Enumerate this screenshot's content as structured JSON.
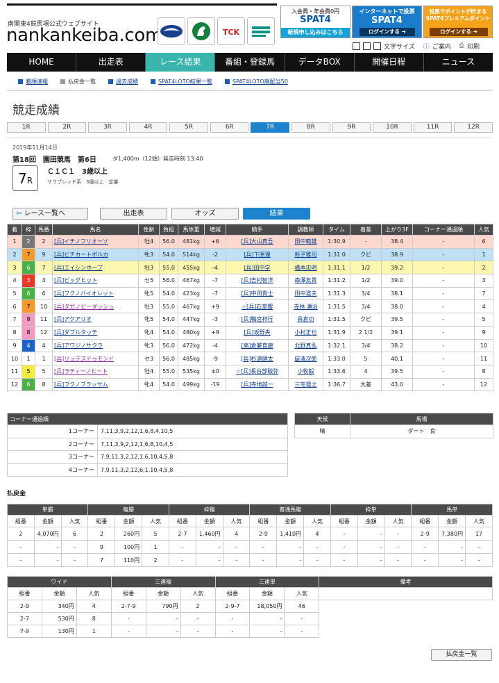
{
  "header": {
    "site_subtitle": "南関東4競馬場公式ウェブサイト",
    "site_logo": "nankankeiba.com",
    "banners": [
      {
        "top": "入会費・年会費0円",
        "mid": "SPAT4",
        "bot": "新規申し込みはこちら"
      },
      {
        "top": "インターネットで投票",
        "mid": "SPAT4",
        "bot": "ログインする ➜"
      },
      {
        "top": "投票でポイントが貯まる SPAT4プレミアムポイント",
        "bot": "ログインする ➜"
      }
    ],
    "util": {
      "font_size": "文字サイズ",
      "guide": "ご案内",
      "print": "印刷"
    }
  },
  "nav": [
    "HOME",
    "出走表",
    "レース結果",
    "番組・登録馬",
    "データBOX",
    "開催日程",
    "ニュース"
  ],
  "subnav": [
    "着順速報",
    "払戻金一覧",
    "過去成績",
    "SPAT4LOTO結果一覧",
    "SPAT4LOTO高配当50"
  ],
  "page_title": "競走成績",
  "race_tabs": [
    "1R",
    "2R",
    "3R",
    "4R",
    "5R",
    "6R",
    "7R",
    "8R",
    "9R",
    "10R",
    "11R",
    "12R"
  ],
  "race": {
    "date": "2019年11月14日",
    "meet": "第18回　園田競馬　第6日",
    "detail": "ダ1,400m（12頭）発走時刻 13:40",
    "class": "Ｃ１Ｃ１　3歳以上",
    "num": "7",
    "num_suffix": "R",
    "cond": "サラブレッド系　3歳以上　定量"
  },
  "buttons": {
    "back": "レース一覧へ",
    "entry": "出走表",
    "odds": "オッズ",
    "result": "結果"
  },
  "results": {
    "headers": [
      "着",
      "枠",
      "馬番",
      "馬名",
      "性齢",
      "負担",
      "馬体重",
      "増減",
      "騎手",
      "調教師",
      "タイム",
      "着差",
      "上がり3F",
      "コーナー通過順",
      "人気"
    ],
    "rows": [
      [
        "1",
        "2",
        "2",
        "[兵]イチノフリオーソ",
        "牡4",
        "56.0",
        "481kg",
        "+6",
        "[兵]大山真吾",
        "田中範雄",
        "1:30.9",
        "-",
        "38.4",
        "-",
        "6"
      ],
      [
        "2",
        "7",
        "9",
        "[兵]ビチカートポルカ",
        "牝3",
        "54.0",
        "514kg",
        "-2",
        "[兵]下原理",
        "新子雅司",
        "1:31.0",
        "クビ",
        "38.9",
        "-",
        "1"
      ],
      [
        "3",
        "6",
        "7",
        "[兵]エイシンホープ",
        "牡3",
        "55.0",
        "455kg",
        "-4",
        "[兵]田中学",
        "橋本忠明",
        "1:31.1",
        "1/2",
        "39.2",
        "-",
        "2"
      ],
      [
        "4",
        "3",
        "3",
        "[兵]ビッグヒット",
        "セ5",
        "56.0",
        "467kg",
        "-7",
        "[兵]吉村智洋",
        "森澤友貴",
        "1:31.2",
        "1/2",
        "39.0",
        "-",
        "3"
      ],
      [
        "5",
        "6",
        "6",
        "[兵]フクノバイオレット",
        "牝5",
        "54.0",
        "423kg",
        "-7",
        "[兵]中田貴士",
        "田中道夫",
        "1:31.3",
        "3/4",
        "38.1",
        "-",
        "7"
      ],
      [
        "6",
        "7",
        "10",
        "[兵]タガノビーダッシュ",
        "牡3",
        "55.0",
        "467kg",
        "+9",
        "☆[兵]石堂響",
        "寺林 瀬治",
        "1:31.5",
        "3/4",
        "38.0",
        "-",
        "4"
      ],
      [
        "7",
        "8",
        "11",
        "[兵]アクアリオ",
        "牝5",
        "54.0",
        "447kg",
        "-3",
        "[兵]鴨宮祥行",
        "長倉功",
        "1:31.5",
        "クビ",
        "39.5",
        "-",
        "5"
      ],
      [
        "8",
        "8",
        "12",
        "[兵]ダブルタッチ",
        "牝4",
        "54.0",
        "480kg",
        "+9",
        "[兵]坂野央",
        "小村正也",
        "1:31.9",
        "2 1/2",
        "39.1",
        "-",
        "9"
      ],
      [
        "9",
        "4",
        "4",
        "[兵]アワジノサクラ",
        "牝3",
        "56.0",
        "472kg",
        "-4",
        "[高]倉兼育康",
        "北野真弘",
        "1:32.1",
        "3/4",
        "38.2",
        "-",
        "10"
      ],
      [
        "10",
        "1",
        "1",
        "[兵]リュデスドゥモンド",
        "セ3",
        "56.0",
        "485kg",
        "-9",
        "[兵]杉浦健太",
        "碇清次郎",
        "1:33.0",
        "5",
        "40.1",
        "-",
        "11"
      ],
      [
        "11",
        "5",
        "5",
        "[兵]ラティーノヒート",
        "牡4",
        "55.0",
        "535kg",
        "±0",
        "☆[兵]長谷部駿弥",
        "小牧毅",
        "1:33.6",
        "4",
        "39.5",
        "-",
        "8"
      ],
      [
        "12",
        "6",
        "8",
        "[兵]フクノブラッサム",
        "牝4",
        "54.0",
        "499kg",
        "-19",
        "[兵]寺地誠一",
        "三宅邉之",
        "1:36.7",
        "大差",
        "43.0",
        "-",
        "12"
      ]
    ]
  },
  "corners": {
    "title": "コーナー通過順",
    "rows": [
      [
        "1コーナー",
        "7,11,3,9,2,12,1,6,8,4,10,5"
      ],
      [
        "2コーナー",
        "7,11,3,9,2,12,1,6,8,10,4,5"
      ],
      [
        "3コーナー",
        "7,9,11,3,2,12,1,6,10,4,5,8"
      ],
      [
        "4コーナー",
        "7,9,11,3,2,12,6,1,10,4,5,8"
      ]
    ]
  },
  "weather": {
    "headers": [
      "天候",
      "馬場"
    ],
    "values": [
      "晴",
      "ダート　良"
    ]
  },
  "payout": {
    "title": "払戻金",
    "group1_headers": [
      "単勝",
      "複勝",
      "枠複",
      "普通馬複",
      "枠単",
      "馬単"
    ],
    "sub_headers": [
      "組番",
      "金額",
      "人気"
    ],
    "group1_rows": [
      [
        "2",
        "4,070円",
        "6",
        "2",
        "260円",
        "5",
        "2-7",
        "1,460円",
        "4",
        "2-9",
        "1,410円",
        "4",
        "-",
        "-",
        "-",
        "2-9",
        "7,380円",
        "17"
      ],
      [
        "-",
        "-",
        "-",
        "9",
        "100円",
        "1",
        "-",
        "-",
        "-",
        "-",
        "-",
        "-",
        "-",
        "-",
        "-",
        "-",
        "-",
        "-"
      ],
      [
        "-",
        "-",
        "-",
        "7",
        "110円",
        "2",
        "-",
        "-",
        "-",
        "-",
        "-",
        "-",
        "-",
        "-",
        "-",
        "-",
        "-",
        "-"
      ]
    ],
    "group2_headers": [
      "ワイド",
      "三連複",
      "三連単",
      "備考"
    ],
    "group2_rows": [
      [
        "2-9",
        "340円",
        "4",
        "2-7-9",
        "790円",
        "2",
        "2-9-7",
        "18,050円",
        "46"
      ],
      [
        "2-7",
        "530円",
        "8",
        "-",
        "-",
        "-",
        "-",
        "-",
        "-"
      ],
      [
        "7-9",
        "130円",
        "1",
        "-",
        "-",
        "-",
        "-",
        "-",
        "-"
      ]
    ],
    "list_button": "払戻金一覧"
  },
  "colors": {
    "nav_active": "#3ab5ad",
    "accent_blue": "#1d83cf",
    "first_row": "#fcd8cf",
    "second_row": "#bfe0f5",
    "third_row": "#fbf7ae"
  }
}
